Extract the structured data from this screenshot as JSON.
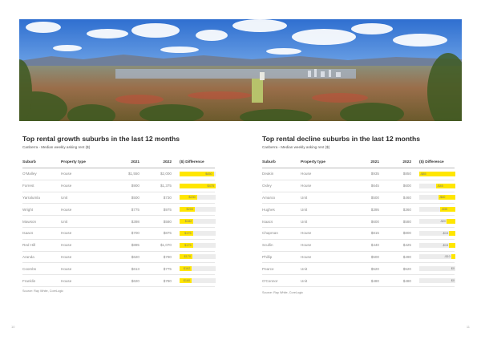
{
  "left": {
    "title": "Top rental growth suburbs in the last 12 months",
    "subtitle": "Canberra - Median weekly asking rent ($)",
    "headers": [
      "Suburb",
      "Property type",
      "2021",
      "2022",
      "($) Difference"
    ],
    "max_diff": 475,
    "rows": [
      {
        "suburb": "O'Malley",
        "type": "House",
        "y2021": "$1,550",
        "y2022": "$2,000",
        "diff": "$450",
        "diff_value": 450
      },
      {
        "suburb": "Forrest",
        "type": "House",
        "y2021": "$900",
        "y2022": "$1,375",
        "diff": "$475",
        "diff_value": 475
      },
      {
        "suburb": "Yarralumla",
        "type": "Unit",
        "y2021": "$500",
        "y2022": "$730",
        "diff": "$230",
        "diff_value": 230
      },
      {
        "suburb": "Wright",
        "type": "House",
        "y2021": "$775",
        "y2022": "$975",
        "diff": "$200",
        "diff_value": 200
      },
      {
        "suburb": "Mawson",
        "type": "Unit",
        "y2021": "$398",
        "y2022": "$580",
        "diff": "$182",
        "diff_value": 182
      },
      {
        "suburb": "Isaacs",
        "type": "House",
        "y2021": "$700",
        "y2022": "$875",
        "diff": "$175",
        "diff_value": 175
      },
      {
        "suburb": "Red Hill",
        "type": "House",
        "y2021": "$895",
        "y2022": "$1,070",
        "diff": "$175",
        "diff_value": 175
      },
      {
        "suburb": "Aranda",
        "type": "House",
        "y2021": "$620",
        "y2022": "$790",
        "diff": "$170",
        "diff_value": 170
      },
      {
        "suburb": "Coombs",
        "type": "House",
        "y2021": "$613",
        "y2022": "$775",
        "diff": "$162",
        "diff_value": 162
      },
      {
        "suburb": "Franklin",
        "type": "House",
        "y2021": "$620",
        "y2022": "$780",
        "diff": "$160",
        "diff_value": 160
      }
    ],
    "source": "Source: Ray White, CoreLogic",
    "page_number": "10"
  },
  "right": {
    "title": "Top rental decline suburbs in the last 12 months",
    "subtitle": "Canberra - Median weekly asking rent ($)",
    "headers": [
      "Suburb",
      "Property type",
      "2021",
      "2022",
      "($) Difference"
    ],
    "max_diff": 85,
    "rows": [
      {
        "suburb": "Deakin",
        "type": "House",
        "y2021": "$935",
        "y2022": "$850",
        "diff": "-$85",
        "diff_value": -85
      },
      {
        "suburb": "Oxley",
        "type": "House",
        "y2021": "$645",
        "y2022": "$600",
        "diff": "-$45",
        "diff_value": -45
      },
      {
        "suburb": "Amaroo",
        "type": "Unit",
        "y2021": "$500",
        "y2022": "$460",
        "diff": "-$40",
        "diff_value": -40
      },
      {
        "suburb": "Hughes",
        "type": "Unit",
        "y2021": "$395",
        "y2022": "$360",
        "diff": "-$35",
        "diff_value": -35
      },
      {
        "suburb": "Isaacs",
        "type": "Unit",
        "y2021": "$600",
        "y2022": "$580",
        "diff": "-$20",
        "diff_value": -20
      },
      {
        "suburb": "Chapman",
        "type": "House",
        "y2021": "$815",
        "y2022": "$800",
        "diff": "-$15",
        "diff_value": -15
      },
      {
        "suburb": "Scullin",
        "type": "House",
        "y2021": "$440",
        "y2022": "$425",
        "diff": "-$15",
        "diff_value": -15
      },
      {
        "suburb": "Phillip",
        "type": "House",
        "y2021": "$500",
        "y2022": "$490",
        "diff": "-$10",
        "diff_value": -10
      },
      {
        "suburb": "Pearce",
        "type": "Unit",
        "y2021": "$520",
        "y2022": "$520",
        "diff": "$0",
        "diff_value": 0
      },
      {
        "suburb": "O'Connor",
        "type": "Unit",
        "y2021": "$480",
        "y2022": "$480",
        "diff": "$0",
        "diff_value": 0
      }
    ],
    "source": "Source: Ray White, CoreLogic",
    "page_number": "11"
  }
}
